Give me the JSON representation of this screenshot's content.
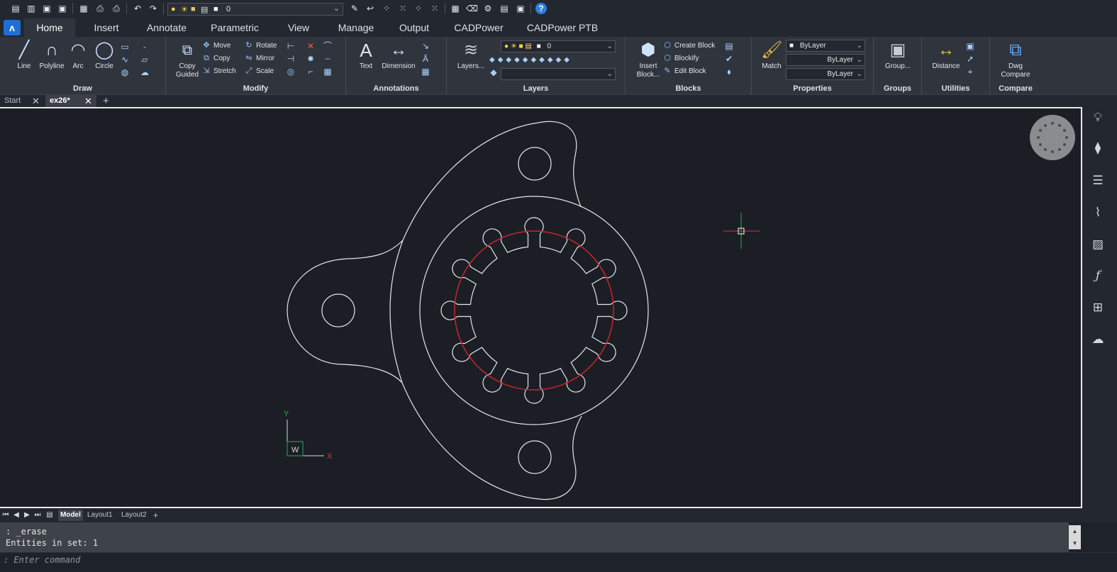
{
  "qat": {
    "layer_name": "0"
  },
  "tabs": [
    "Home",
    "Insert",
    "Annotate",
    "Parametric",
    "View",
    "Manage",
    "Output",
    "CADPower",
    "CADPower PTB"
  ],
  "ribbon": {
    "draw": {
      "title": "Draw",
      "line": "Line",
      "polyline": "Polyline",
      "arc": "Arc",
      "circle": "Circle"
    },
    "modify": {
      "title": "Modify",
      "copy_guided": "Copy\nGuided",
      "move": "Move",
      "copy": "Copy",
      "stretch": "Stretch",
      "rotate": "Rotate",
      "mirror": "Mirror",
      "scale": "Scale"
    },
    "annotations": {
      "title": "Annotations",
      "text": "Text",
      "dimension": "Dimension"
    },
    "layers": {
      "title": "Layers",
      "layers_btn": "Layers...",
      "current_layer": "0"
    },
    "blocks": {
      "title": "Blocks",
      "insert_block": "Insert\nBlock...",
      "create_block": "Create Block",
      "blockify": "Blockify",
      "edit_block": "Edit Block"
    },
    "properties": {
      "title": "Properties",
      "match": "Match",
      "color": "ByLayer",
      "linetype": "ByLayer",
      "lineweight": "ByLayer"
    },
    "groups": {
      "title": "Groups",
      "group": "Group..."
    },
    "utilities": {
      "title": "Utilities",
      "distance": "Distance"
    },
    "compare": {
      "title": "Compare",
      "dwg_compare": "Dwg\nCompare"
    }
  },
  "doctabs": {
    "start": "Start",
    "current": "ex26*"
  },
  "ucs": {
    "x": "X",
    "y": "Y",
    "w": "W"
  },
  "layouts": [
    "Model",
    "Layout1",
    "Layout2"
  ],
  "command": {
    "history": [
      ": _erase",
      "Entities in set: 1"
    ],
    "prompt": ": Enter command"
  }
}
